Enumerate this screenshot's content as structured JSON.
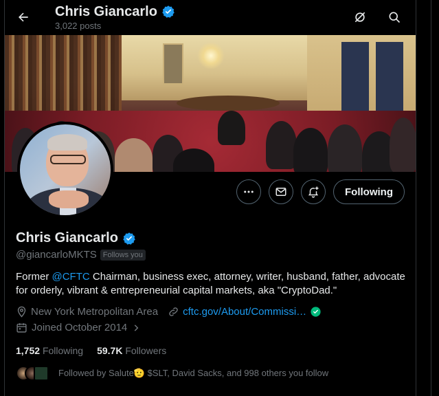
{
  "header": {
    "name": "Chris Giancarlo",
    "posts": "3,022 posts"
  },
  "profile": {
    "name": "Chris Giancarlo",
    "handle": "@giancarloMKTS",
    "follows_you": "Follows you",
    "bio_prefix": "Former ",
    "bio_mention": "@CFTC",
    "bio_rest": " Chairman, business exec, attorney, writer, husband, father, advocate for orderly, vibrant & entrepreneurial capital markets, aka \"CryptoDad.\"",
    "location": "New York Metropolitan Area",
    "website": "cftc.gov/About/Commissi…",
    "joined": "Joined October 2014"
  },
  "actions": {
    "following_label": "Following"
  },
  "stats": {
    "following_count": "1,752",
    "following_label": "Following",
    "followers_count": "59.7K",
    "followers_label": "Followers"
  },
  "followed_by": "Followed by Salute🫡 $SLT, David Sacks, and 998 others you follow",
  "colors": {
    "accent": "#1d9bf0",
    "verified": "#1d9bf0",
    "background": "#000000",
    "muted": "#71767b",
    "link_verified": "#00ba7c"
  }
}
